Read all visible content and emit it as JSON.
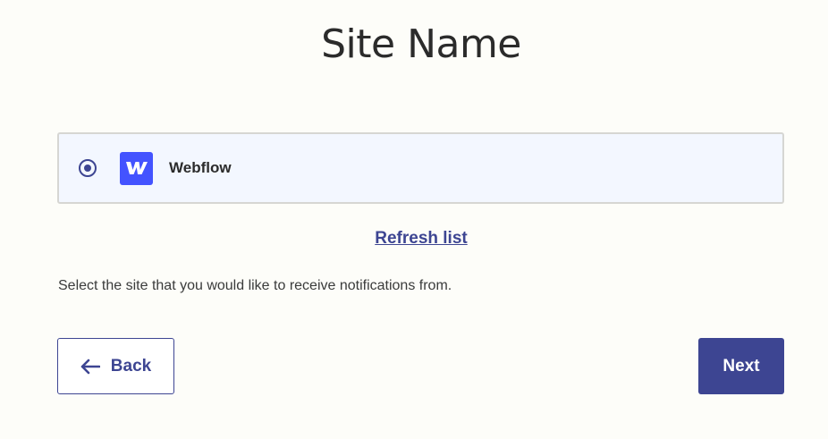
{
  "page": {
    "title": "Site Name"
  },
  "site_list": {
    "options": [
      {
        "label": "Webflow",
        "selected": true,
        "icon": "webflow-logo",
        "icon_glyph": "W",
        "icon_color": "#4353ff"
      }
    ]
  },
  "refresh": {
    "label": "Refresh list"
  },
  "help_text": "Select the site that you would like to receive notifications from.",
  "actions": {
    "back_label": "Back",
    "back_icon": "arrow-left-icon",
    "next_label": "Next"
  },
  "colors": {
    "accent": "#3d4592",
    "background": "#fdfdf9",
    "selected_row": "#f3f7ff"
  }
}
